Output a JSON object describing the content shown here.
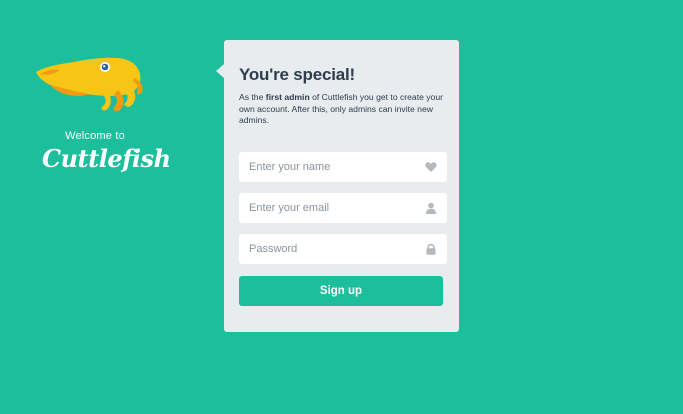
{
  "brand": {
    "logo_icon": "cuttlefish-logo-icon",
    "welcome_text": "Welcome to",
    "wordmark": "Cuttlefish"
  },
  "signup_card": {
    "title": "You're special!",
    "description_prefix": "As the ",
    "description_bold": "first admin",
    "description_suffix": " of Cuttlefish you get to create your own account. After this, only admins can invite new admins.",
    "name_field": {
      "placeholder": "Enter your name",
      "value": "",
      "icon": "heart-icon"
    },
    "email_field": {
      "placeholder": "Enter your email",
      "value": "",
      "icon": "user-icon"
    },
    "password_field": {
      "placeholder": "Password",
      "value": "",
      "icon": "lock-icon"
    },
    "submit_label": "Sign up"
  },
  "colors": {
    "background": "#1dbe9c",
    "card": "#e9ecef",
    "button": "#1dbe9c",
    "title_text": "#2d3d4f",
    "logo_body": "#f6c515",
    "icon": "#b3b9be"
  }
}
